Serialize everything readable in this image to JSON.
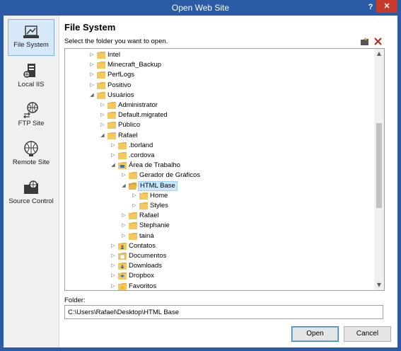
{
  "window": {
    "title": "Open Web Site",
    "help_glyph": "?",
    "close_glyph": "✕"
  },
  "sidebar": {
    "items": [
      {
        "label": "File System",
        "icon": "file-system-icon",
        "active": true
      },
      {
        "label": "Local IIS",
        "icon": "local-iis-icon",
        "active": false
      },
      {
        "label": "FTP Site",
        "icon": "ftp-site-icon",
        "active": false
      },
      {
        "label": "Remote Site",
        "icon": "remote-site-icon",
        "active": false
      },
      {
        "label": "Source Control",
        "icon": "source-control-icon",
        "active": false
      }
    ]
  },
  "main": {
    "heading": "File System",
    "subheading": "Select the folder you want to open.",
    "toolbar": {
      "new_folder_icon": "new-folder-icon",
      "delete_icon": "delete-icon"
    }
  },
  "tree": {
    "rows": [
      {
        "label": "Intel",
        "depth": 0,
        "state": "collapsed",
        "folder": "folder"
      },
      {
        "label": "Minecraft_Backup",
        "depth": 0,
        "state": "collapsed",
        "folder": "folder"
      },
      {
        "label": "PerfLogs",
        "depth": 0,
        "state": "collapsed",
        "folder": "folder"
      },
      {
        "label": "Positivo",
        "depth": 0,
        "state": "collapsed",
        "folder": "folder"
      },
      {
        "label": "Usuários",
        "depth": 0,
        "state": "expanded",
        "folder": "folder"
      },
      {
        "label": "Administrator",
        "depth": 1,
        "state": "collapsed",
        "folder": "folder"
      },
      {
        "label": "Default.migrated",
        "depth": 1,
        "state": "collapsed",
        "folder": "folder"
      },
      {
        "label": "Público",
        "depth": 1,
        "state": "collapsed",
        "folder": "folder"
      },
      {
        "label": "Rafael",
        "depth": 1,
        "state": "expanded",
        "folder": "folder"
      },
      {
        "label": ".borland",
        "depth": 2,
        "state": "collapsed",
        "folder": "folder"
      },
      {
        "label": ".cordova",
        "depth": 2,
        "state": "collapsed",
        "folder": "folder"
      },
      {
        "label": "Área de Trabalho",
        "depth": 2,
        "state": "expanded",
        "folder": "desktop"
      },
      {
        "label": "Gerador de Gráficos",
        "depth": 3,
        "state": "collapsed",
        "folder": "folder"
      },
      {
        "label": "HTML Base",
        "depth": 3,
        "state": "expanded",
        "folder": "folder-open",
        "selected": true
      },
      {
        "label": "Home",
        "depth": 4,
        "state": "collapsed",
        "folder": "folder"
      },
      {
        "label": "Styles",
        "depth": 4,
        "state": "collapsed",
        "folder": "folder"
      },
      {
        "label": "Rafael",
        "depth": 3,
        "state": "collapsed",
        "folder": "folder"
      },
      {
        "label": "Stephanie",
        "depth": 3,
        "state": "collapsed",
        "folder": "folder"
      },
      {
        "label": "tainá",
        "depth": 3,
        "state": "collapsed",
        "folder": "folder"
      },
      {
        "label": "Contatos",
        "depth": 2,
        "state": "collapsed",
        "folder": "contacts"
      },
      {
        "label": "Documentos",
        "depth": 2,
        "state": "collapsed",
        "folder": "documents"
      },
      {
        "label": "Downloads",
        "depth": 2,
        "state": "collapsed",
        "folder": "downloads"
      },
      {
        "label": "Dropbox",
        "depth": 2,
        "state": "collapsed",
        "folder": "dropbox"
      },
      {
        "label": "Favoritos",
        "depth": 2,
        "state": "collapsed",
        "folder": "favorites"
      }
    ]
  },
  "folder": {
    "label": "Folder:",
    "value": "C:\\Users\\Rafael\\Desktop\\HTML Base"
  },
  "buttons": {
    "open": "Open",
    "cancel": "Cancel"
  },
  "colors": {
    "titlebar": "#2b5aa6",
    "close": "#c7392b",
    "folder": "#e8b84a",
    "selection": "#cce8ff",
    "sidebar_active": "#d7e8f9"
  }
}
